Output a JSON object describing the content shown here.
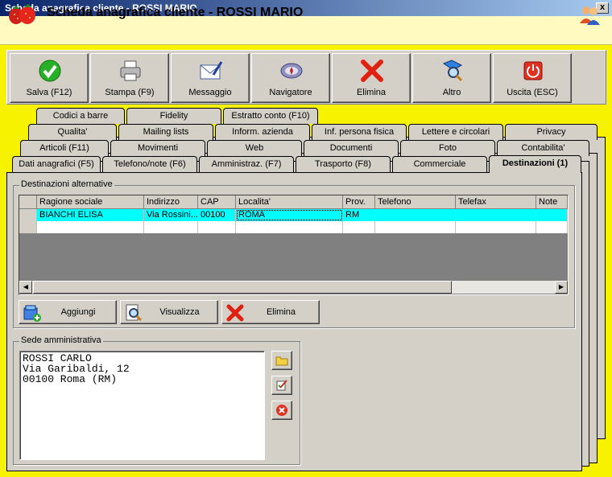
{
  "window": {
    "title": "Scheda anagrafica cliente - ROSSI MARIO",
    "close": "x"
  },
  "header": {
    "title": "Scheda anagrafica cliente - ROSSI MARIO",
    "app_icon": "strawberry-icon",
    "user_icon": "users-icon"
  },
  "toolbar": [
    {
      "label": "Salva (F12)",
      "icon": "check-icon"
    },
    {
      "label": "Stampa (F9)",
      "icon": "printer-icon"
    },
    {
      "label": "Messaggio",
      "icon": "mail-icon"
    },
    {
      "label": "Navigatore",
      "icon": "compass-icon"
    },
    {
      "label": "Elimina",
      "icon": "delete-x-icon"
    },
    {
      "label": "Altro",
      "icon": "book-search-icon"
    },
    {
      "label": "Uscita (ESC)",
      "icon": "power-icon"
    }
  ],
  "tabs": {
    "row1": [
      "Codici a barre",
      "Fidelity",
      "Estratto conto (F10)"
    ],
    "row2": [
      "Qualita'",
      "Mailing lists",
      "Inform. azienda",
      "Inf. persona fisica",
      "Lettere e circolari",
      "Privacy"
    ],
    "row3": [
      "Articoli (F11)",
      "Movimenti",
      "Web",
      "Documenti",
      "Foto",
      "Contabilita'"
    ],
    "row4": [
      "Dati anagrafici (F5)",
      "Telefono/note (F6)",
      "Amministraz. (F7)",
      "Trasporto (F8)",
      "Commerciale",
      "Destinazioni (1)"
    ]
  },
  "destinations": {
    "group_label": "Destinazioni alternative",
    "columns": [
      "Ragione sociale",
      "Indirizzo",
      "CAP",
      "Localita'",
      "Prov.",
      "Telefono",
      "Telefax",
      "Note"
    ],
    "rows": [
      [
        "BIANCHI ELISA",
        "Via Rossini...",
        "00100",
        "ROMA",
        "RM",
        "",
        "",
        ""
      ]
    ],
    "buttons": {
      "add": "Aggiungi",
      "view": "Visualizza",
      "delete": "Elimina"
    }
  },
  "admin": {
    "group_label": "Sede amministrativa",
    "address": "ROSSI CARLO\nVia Garibaldi, 12\n00100 Roma (RM)"
  },
  "colors": {
    "background": "#f7f300",
    "selected_row": "#00ffff",
    "panel": "#d4d0c8"
  }
}
